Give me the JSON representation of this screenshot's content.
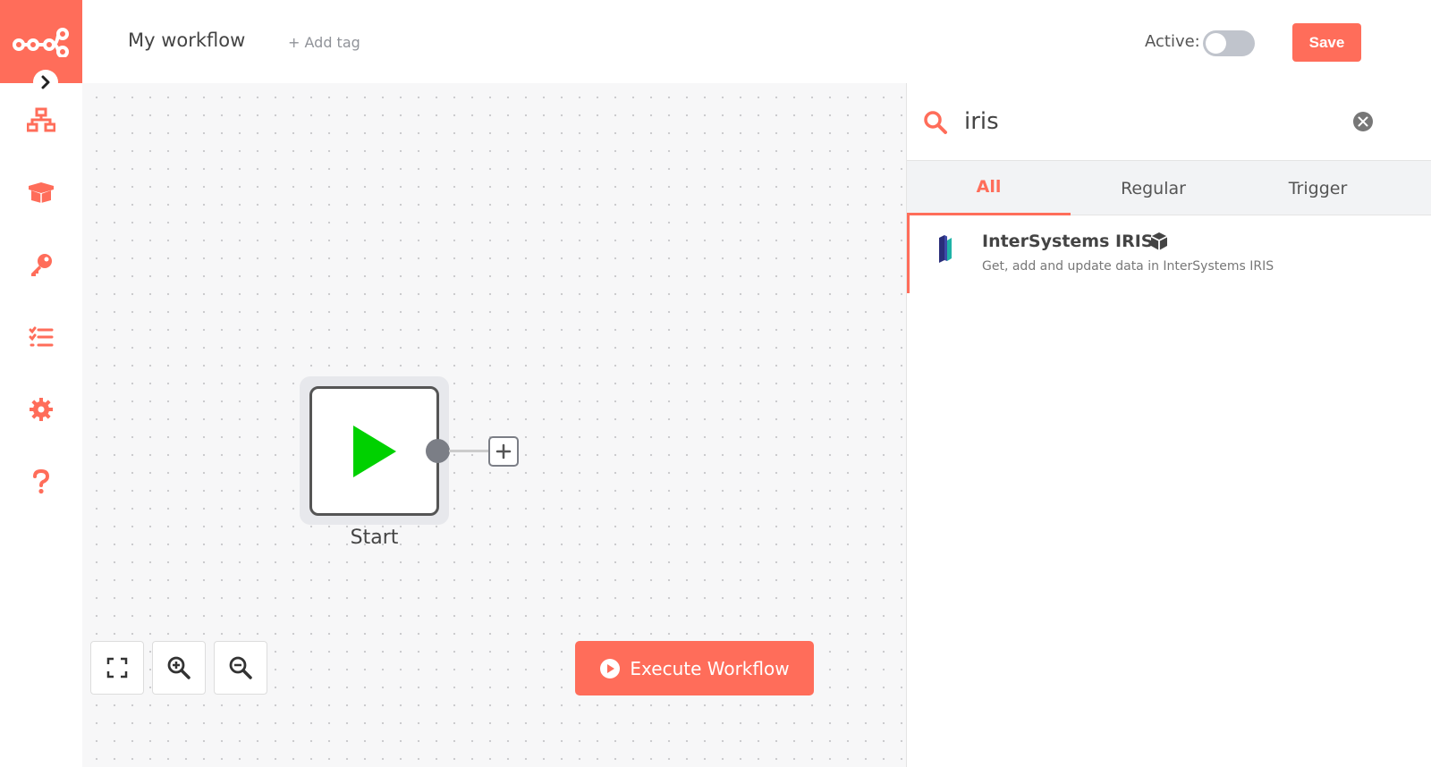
{
  "header": {
    "workflow_title": "My workflow",
    "add_tag": "+ Add tag",
    "active_label": "Active:",
    "active": false,
    "save_label": "Save"
  },
  "sidebar": {
    "items": [
      {
        "name": "workflows-icon"
      },
      {
        "name": "templates-icon"
      },
      {
        "name": "credentials-icon"
      },
      {
        "name": "executions-icon"
      },
      {
        "name": "settings-icon"
      },
      {
        "name": "help-icon"
      }
    ]
  },
  "canvas": {
    "start_node_label": "Start",
    "execute_label": "Execute Workflow"
  },
  "panel": {
    "search_value": "iris",
    "tabs": [
      {
        "label": "All",
        "active": true
      },
      {
        "label": "Regular",
        "active": false
      },
      {
        "label": "Trigger",
        "active": false
      }
    ],
    "results": [
      {
        "title": "InterSystems IRIS",
        "description": "Get, add and update data in InterSystems IRIS"
      }
    ]
  },
  "colors": {
    "accent": "#ff6d5a",
    "start_play": "#00d100"
  }
}
